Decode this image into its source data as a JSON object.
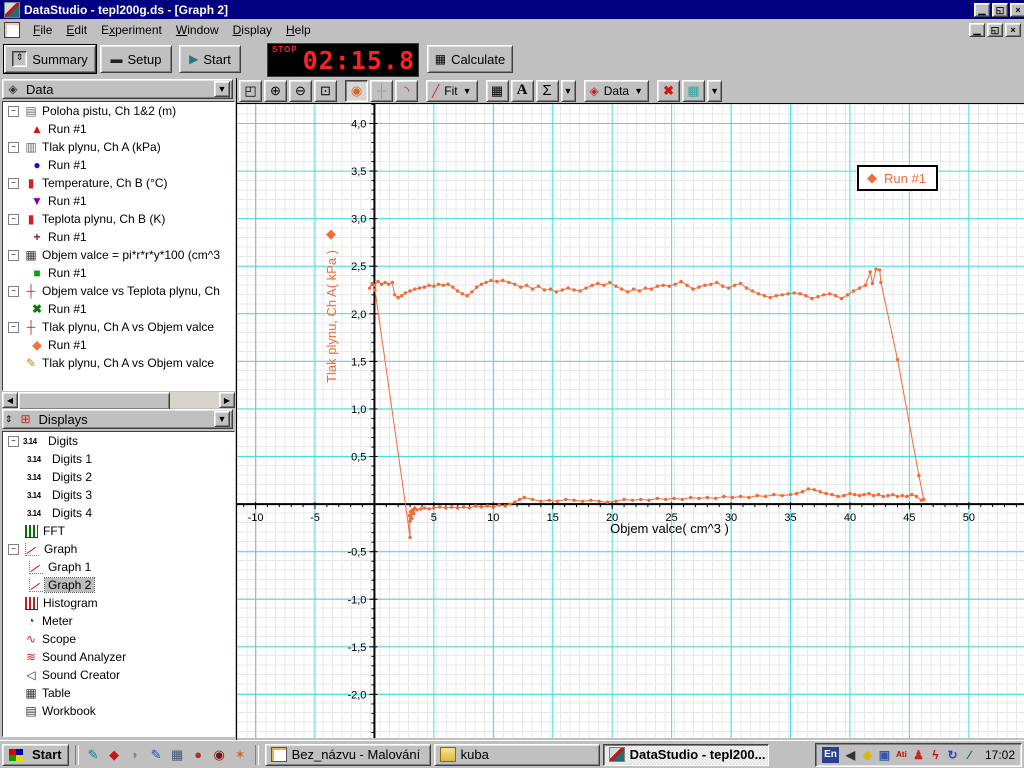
{
  "window": {
    "title": "DataStudio - tepl200g.ds - [Graph 2]"
  },
  "menu": {
    "items": [
      {
        "label": "File",
        "u": 0
      },
      {
        "label": "Edit",
        "u": 0
      },
      {
        "label": "Experiment",
        "u": 1
      },
      {
        "label": "Window",
        "u": 0
      },
      {
        "label": "Display",
        "u": 0
      },
      {
        "label": "Help",
        "u": 0
      }
    ]
  },
  "toolbar": {
    "summary_label": "Summary",
    "setup_label": "Setup",
    "start_label": "Start",
    "stop_label": "STOP",
    "timer_value": "02:15.8",
    "calculate_label": "Calculate"
  },
  "graph_toolbar": {
    "fit_label": "Fit",
    "data_label": "Data",
    "sigma_label": "Σ",
    "text_label": "A"
  },
  "sidebar": {
    "data_panel": {
      "title": "Data",
      "items": [
        {
          "label": "Poloha pistu, Ch 1&2 (m)",
          "icon": "motion-sensor-icon",
          "run": {
            "label": "Run #1",
            "marker": "▲",
            "color": "#dd1111"
          }
        },
        {
          "label": "Tlak plynu, Ch A (kPa)",
          "icon": "pressure-sensor-icon",
          "run": {
            "label": "Run #1",
            "marker": "●",
            "color": "#1111cc"
          }
        },
        {
          "label": "Temperature, Ch B (°C)",
          "icon": "thermometer-icon",
          "run": {
            "label": "Run #1",
            "marker": "▼",
            "color": "#8800aa"
          }
        },
        {
          "label": "Teplota plynu, Ch B (K)",
          "icon": "thermometer-icon",
          "run": {
            "label": "Run #1",
            "marker": "+",
            "color": "#991111"
          }
        },
        {
          "label": "Objem valce = pi*r*r*y*100 (cm^3",
          "icon": "calculator-icon",
          "run": {
            "label": "Run #1",
            "marker": "■",
            "color": "#11a011"
          }
        },
        {
          "label": "Objem valce vs Teplota plynu, Ch",
          "icon": "xy-data-icon",
          "run": {
            "label": "Run #1",
            "marker": "✖",
            "color": "#0a7a0a"
          }
        },
        {
          "label": "Tlak plynu, Ch A vs Objem valce",
          "icon": "xy-data-icon",
          "run": {
            "label": "Run #1",
            "marker": "◆",
            "color": "#f4713c"
          }
        },
        {
          "label": "Tlak plynu, Ch A vs Objem valce",
          "icon": "pencil-icon",
          "run": null
        }
      ]
    },
    "displays_panel": {
      "title": "Displays",
      "items": [
        {
          "label": "Digits",
          "icon": "digits-icon",
          "children": [
            {
              "label": "Digits 1"
            },
            {
              "label": "Digits 2"
            },
            {
              "label": "Digits 3"
            },
            {
              "label": "Digits 4"
            }
          ]
        },
        {
          "label": "FFT",
          "icon": "fft-icon"
        },
        {
          "label": "Graph",
          "icon": "graph-icon",
          "children": [
            {
              "label": "Graph 1"
            },
            {
              "label": "Graph 2",
              "selected": true
            }
          ]
        },
        {
          "label": "Histogram",
          "icon": "histogram-icon"
        },
        {
          "label": "Meter",
          "icon": "meter-icon"
        },
        {
          "label": "Scope",
          "icon": "scope-icon"
        },
        {
          "label": "Sound Analyzer",
          "icon": "sound-analyzer-icon"
        },
        {
          "label": "Sound Creator",
          "icon": "sound-creator-icon"
        },
        {
          "label": "Table",
          "icon": "table-icon"
        },
        {
          "label": "Workbook",
          "icon": "workbook-icon"
        }
      ]
    }
  },
  "chart_data": {
    "type": "scatter",
    "title": "",
    "xlabel": "Objem valce( cm^3 )",
    "ylabel": "Tlak plynu, Ch A( kPa )",
    "legend": {
      "label": "Run #1",
      "marker": "◆"
    },
    "grid": "on",
    "grid_color": "#44dede",
    "xlim": [
      -11.56,
      54.64
    ],
    "ylim": [
      -2.458,
      4.205
    ],
    "x_ticks": [
      {
        "v": -10,
        "l": "-10"
      },
      {
        "v": -5,
        "l": "-5"
      },
      {
        "v": 5,
        "l": "5"
      },
      {
        "v": 10,
        "l": "10"
      },
      {
        "v": 15,
        "l": "15"
      },
      {
        "v": 20,
        "l": "20"
      },
      {
        "v": 25,
        "l": "25"
      },
      {
        "v": 30,
        "l": "30"
      },
      {
        "v": 35,
        "l": "35"
      },
      {
        "v": 40,
        "l": "40"
      },
      {
        "v": 45,
        "l": "45"
      },
      {
        "v": 50,
        "l": "50"
      }
    ],
    "y_ticks": [
      {
        "v": -2,
        "l": "-2,0"
      },
      {
        "v": -1.5,
        "l": "-1,5"
      },
      {
        "v": -1,
        "l": "-1,0"
      },
      {
        "v": -0.5,
        "l": "-0,5"
      },
      {
        "v": 0.5,
        "l": "0,5"
      },
      {
        "v": 1,
        "l": "1,0"
      },
      {
        "v": 1.5,
        "l": "1,5"
      },
      {
        "v": 2,
        "l": "2,0"
      },
      {
        "v": 2.5,
        "l": "2,5"
      },
      {
        "v": 3,
        "l": "3,0"
      },
      {
        "v": 3.5,
        "l": "3,5"
      },
      {
        "v": 4,
        "l": "4,0"
      }
    ],
    "series": [
      {
        "name": "Run #1",
        "color": "#f26a38",
        "points": [
          [
            -0.4,
            2.27
          ],
          [
            -0.2,
            2.32
          ],
          [
            0,
            2.3
          ],
          [
            0.3,
            2.34
          ],
          [
            0.6,
            2.31
          ],
          [
            0.9,
            2.33
          ],
          [
            1.2,
            2.31
          ],
          [
            1.5,
            2.33
          ],
          [
            1.7,
            2.2
          ],
          [
            2.0,
            2.17
          ],
          [
            2.3,
            2.19
          ],
          [
            2.6,
            2.22
          ],
          [
            3.0,
            2.24
          ],
          [
            3.4,
            2.26
          ],
          [
            3.8,
            2.27
          ],
          [
            4.2,
            2.28
          ],
          [
            4.6,
            2.3
          ],
          [
            5.0,
            2.29
          ],
          [
            5.4,
            2.31
          ],
          [
            5.8,
            2.3
          ],
          [
            6.2,
            2.31
          ],
          [
            6.6,
            2.28
          ],
          [
            7.0,
            2.24
          ],
          [
            7.4,
            2.21
          ],
          [
            7.8,
            2.19
          ],
          [
            8.2,
            2.23
          ],
          [
            8.6,
            2.28
          ],
          [
            9.0,
            2.31
          ],
          [
            9.4,
            2.33
          ],
          [
            9.8,
            2.35
          ],
          [
            10.3,
            2.34
          ],
          [
            10.8,
            2.35
          ],
          [
            11.3,
            2.33
          ],
          [
            11.8,
            2.31
          ],
          [
            12.3,
            2.28
          ],
          [
            12.8,
            2.3
          ],
          [
            13.3,
            2.26
          ],
          [
            13.8,
            2.29
          ],
          [
            14.3,
            2.25
          ],
          [
            14.8,
            2.26
          ],
          [
            15.3,
            2.23
          ],
          [
            15.8,
            2.25
          ],
          [
            16.3,
            2.27
          ],
          [
            16.8,
            2.25
          ],
          [
            17.3,
            2.24
          ],
          [
            17.8,
            2.27
          ],
          [
            18.3,
            2.3
          ],
          [
            18.8,
            2.32
          ],
          [
            19.3,
            2.3
          ],
          [
            19.8,
            2.33
          ],
          [
            20.3,
            2.29
          ],
          [
            20.8,
            2.26
          ],
          [
            21.3,
            2.23
          ],
          [
            21.8,
            2.26
          ],
          [
            22.3,
            2.24
          ],
          [
            22.8,
            2.27
          ],
          [
            23.3,
            2.26
          ],
          [
            23.8,
            2.29
          ],
          [
            24.3,
            2.3
          ],
          [
            24.8,
            2.29
          ],
          [
            25.3,
            2.31
          ],
          [
            25.8,
            2.34
          ],
          [
            26.3,
            2.3
          ],
          [
            26.8,
            2.26
          ],
          [
            27.3,
            2.28
          ],
          [
            27.8,
            2.3
          ],
          [
            28.3,
            2.31
          ],
          [
            28.8,
            2.33
          ],
          [
            29.3,
            2.29
          ],
          [
            29.8,
            2.27
          ],
          [
            30.3,
            2.3
          ],
          [
            30.8,
            2.32
          ],
          [
            31.3,
            2.27
          ],
          [
            31.8,
            2.24
          ],
          [
            32.3,
            2.21
          ],
          [
            32.8,
            2.19
          ],
          [
            33.3,
            2.17
          ],
          [
            33.8,
            2.19
          ],
          [
            34.3,
            2.2
          ],
          [
            34.8,
            2.21
          ],
          [
            35.3,
            2.22
          ],
          [
            35.8,
            2.21
          ],
          [
            36.3,
            2.19
          ],
          [
            36.8,
            2.16
          ],
          [
            37.3,
            2.18
          ],
          [
            37.8,
            2.2
          ],
          [
            38.3,
            2.21
          ],
          [
            38.8,
            2.19
          ],
          [
            39.3,
            2.16
          ],
          [
            39.8,
            2.2
          ],
          [
            40.3,
            2.24
          ],
          [
            40.8,
            2.27
          ],
          [
            41.3,
            2.3
          ],
          [
            41.7,
            2.44
          ],
          [
            41.9,
            2.32
          ],
          [
            42.2,
            2.47
          ],
          [
            42.5,
            2.46
          ],
          [
            42.6,
            2.33
          ],
          [
            44.0,
            1.52
          ],
          [
            45.8,
            0.3
          ],
          [
            46.2,
            0.05
          ],
          [
            46.0,
            0.04
          ],
          [
            45.6,
            0.08
          ],
          [
            45.2,
            0.1
          ],
          [
            44.8,
            0.08
          ],
          [
            44.4,
            0.09
          ],
          [
            44.0,
            0.08
          ],
          [
            43.6,
            0.1
          ],
          [
            43.2,
            0.09
          ],
          [
            42.8,
            0.08
          ],
          [
            42.4,
            0.1
          ],
          [
            42.0,
            0.09
          ],
          [
            41.6,
            0.11
          ],
          [
            41.2,
            0.1
          ],
          [
            40.8,
            0.09
          ],
          [
            40.4,
            0.1
          ],
          [
            40.0,
            0.11
          ],
          [
            39.5,
            0.09
          ],
          [
            39.0,
            0.08
          ],
          [
            38.5,
            0.1
          ],
          [
            38.0,
            0.11
          ],
          [
            37.5,
            0.13
          ],
          [
            37.0,
            0.15
          ],
          [
            36.5,
            0.16
          ],
          [
            36.0,
            0.13
          ],
          [
            35.5,
            0.11
          ],
          [
            35.0,
            0.1
          ],
          [
            34.3,
            0.09
          ],
          [
            33.6,
            0.1
          ],
          [
            32.9,
            0.08
          ],
          [
            32.2,
            0.09
          ],
          [
            31.5,
            0.07
          ],
          [
            30.8,
            0.08
          ],
          [
            30.1,
            0.07
          ],
          [
            29.4,
            0.08
          ],
          [
            28.7,
            0.06
          ],
          [
            28.0,
            0.07
          ],
          [
            27.3,
            0.06
          ],
          [
            26.6,
            0.07
          ],
          [
            25.9,
            0.05
          ],
          [
            25.2,
            0.06
          ],
          [
            24.5,
            0.05
          ],
          [
            23.8,
            0.06
          ],
          [
            23.1,
            0.04
          ],
          [
            22.4,
            0.05
          ],
          [
            21.7,
            0.04
          ],
          [
            21.0,
            0.05
          ],
          [
            20.3,
            0.03
          ],
          [
            19.6,
            0.02
          ],
          [
            18.9,
            0.03
          ],
          [
            18.2,
            0.04
          ],
          [
            17.5,
            0.03
          ],
          [
            16.8,
            0.04
          ],
          [
            16.1,
            0.05
          ],
          [
            15.4,
            0.03
          ],
          [
            14.7,
            0.04
          ],
          [
            14.0,
            0.03
          ],
          [
            13.3,
            0.05
          ],
          [
            12.6,
            0.07
          ],
          [
            12.2,
            0.05
          ],
          [
            11.8,
            0.02
          ],
          [
            11.4,
            0.0
          ],
          [
            11.0,
            -0.02
          ],
          [
            10.5,
            -0.01
          ],
          [
            10.0,
            -0.03
          ],
          [
            9.5,
            -0.02
          ],
          [
            9.0,
            -0.03
          ],
          [
            8.5,
            -0.02
          ],
          [
            8.0,
            -0.04
          ],
          [
            7.5,
            -0.03
          ],
          [
            7.0,
            -0.04
          ],
          [
            6.5,
            -0.03
          ],
          [
            6.0,
            -0.04
          ],
          [
            5.5,
            -0.03
          ],
          [
            5.0,
            -0.04
          ],
          [
            4.6,
            -0.05
          ],
          [
            4.2,
            -0.04
          ],
          [
            3.9,
            -0.05
          ],
          [
            3.6,
            -0.06
          ],
          [
            3.4,
            -0.04
          ],
          [
            3.3,
            -0.1
          ],
          [
            3.2,
            -0.06
          ],
          [
            3.15,
            -0.15
          ],
          [
            3.05,
            -0.08
          ],
          [
            3.0,
            -0.18
          ],
          [
            2.95,
            -0.12
          ],
          [
            3.0,
            -0.35
          ],
          [
            0.05,
            2.25
          ]
        ]
      }
    ]
  },
  "taskbar": {
    "start_label": "Start",
    "quicklaunch": [
      {
        "name": "paint-icon",
        "glyph": "✎",
        "color": "#147a8c"
      },
      {
        "name": "acrobat-reader-icon",
        "glyph": "◆",
        "color": "#c01818"
      },
      {
        "name": "bird-icon",
        "glyph": "◗",
        "color": "#888888"
      },
      {
        "name": "pen-icon",
        "glyph": "✎",
        "color": "#2244cc"
      },
      {
        "name": "calculator-icon",
        "glyph": "▦",
        "color": "#445577"
      },
      {
        "name": "dragon-icon",
        "glyph": "●",
        "color": "#b03030"
      },
      {
        "name": "opera-icon",
        "glyph": "◉",
        "color": "#7a1010"
      },
      {
        "name": "winamp-icon",
        "glyph": "✶",
        "color": "#e06020"
      }
    ],
    "tasks": [
      {
        "label": "Bez_názvu - Malování",
        "active": false
      },
      {
        "label": "kuba",
        "active": false
      },
      {
        "label": "DataStudio - tepl200...",
        "active": true
      }
    ],
    "tray": {
      "lang": "En",
      "icons": [
        {
          "name": "volume-icon",
          "glyph": "◀",
          "color": "#333333"
        },
        {
          "name": "diamond-icon",
          "glyph": "◆",
          "color": "#d8b800"
        },
        {
          "name": "scheduler-icon",
          "glyph": "▣",
          "color": "#3355aa"
        },
        {
          "name": "ati-icon",
          "glyph": "Ati",
          "color": "#cc0000"
        },
        {
          "name": "user-icon",
          "glyph": "♟",
          "color": "#cc2222"
        },
        {
          "name": "lightning-icon",
          "glyph": "ϟ",
          "color": "#cc1111"
        },
        {
          "name": "refresh-icon",
          "glyph": "↻",
          "color": "#2244cc"
        },
        {
          "name": "pen2-icon",
          "glyph": "∕",
          "color": "#226622"
        }
      ],
      "clock": "17:02"
    }
  }
}
